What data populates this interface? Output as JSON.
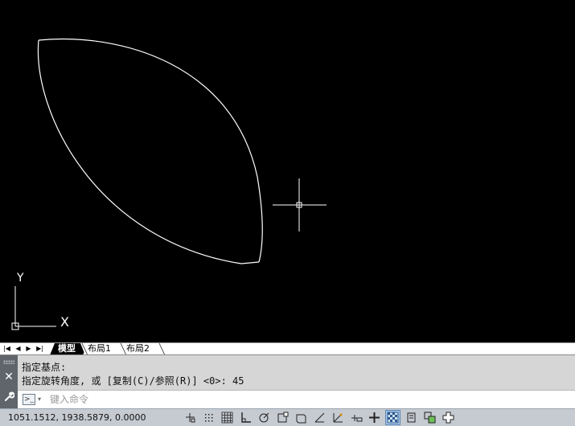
{
  "canvas": {
    "ucs_y_label": "Y",
    "ucs_x_label": "X"
  },
  "layout_tabs": {
    "nav_first": "|◀",
    "nav_prev": "◀",
    "nav_next": "▶",
    "nav_last": "▶|",
    "tabs": [
      "模型",
      "布局1",
      "布局2"
    ]
  },
  "command_window": {
    "history": [
      "指定基点:",
      "指定旋转角度, 或 [复制(C)/参照(R)] <0>: 45"
    ],
    "input_placeholder": "键入命令",
    "input_value": ""
  },
  "status_bar": {
    "coordinates": "1051.1512, 1938.5879, 0.0000",
    "toggles": [
      {
        "name": "infer-constraints",
        "on": false
      },
      {
        "name": "snap-mode",
        "on": false
      },
      {
        "name": "grid-display",
        "on": false
      },
      {
        "name": "ortho-mode",
        "on": false
      },
      {
        "name": "polar-tracking",
        "on": false
      },
      {
        "name": "object-snap",
        "on": false
      },
      {
        "name": "3d-object-snap",
        "on": false
      },
      {
        "name": "object-snap-tracking",
        "on": false
      },
      {
        "name": "dynamic-ucs",
        "on": false
      },
      {
        "name": "dynamic-input",
        "on": false
      },
      {
        "name": "lineweight",
        "on": false
      },
      {
        "name": "transparency",
        "on": true
      },
      {
        "name": "quick-properties",
        "on": false
      },
      {
        "name": "selection-cycling",
        "on": false
      },
      {
        "name": "annotation-monitor",
        "on": false
      }
    ]
  },
  "colors": {
    "canvas_bg": "#000000",
    "geometry": "#ffffff",
    "toggle_on": "#a9c7e8"
  }
}
